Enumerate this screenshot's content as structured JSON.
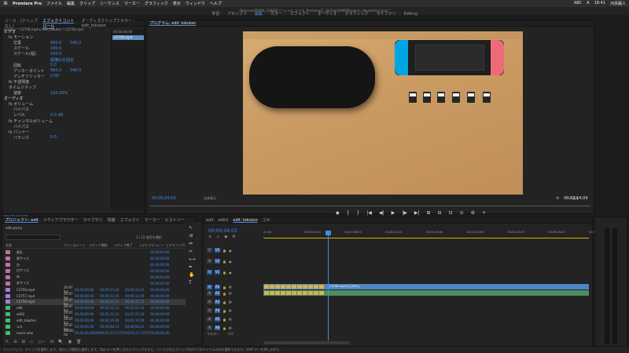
{
  "menubar": {
    "apple": "",
    "app": "Premiere Pro",
    "items": [
      "ファイル",
      "編集",
      "クリップ",
      "シーケンス",
      "マーカー",
      "グラフィック",
      "表示",
      "ウィンドウ",
      "ヘルプ"
    ],
    "right": [
      "ABC",
      "A",
      "18:41",
      "河添麗人"
    ]
  },
  "window_title": "/Volumes/WORK_128GB/ソーシャル_ビデオ_Premiere/Z_2023/edit/MM/Product_video/edit.prproj *",
  "workspaces": [
    "学習",
    "アセンブリ",
    "編集",
    "カラー",
    "エフェクト",
    "オーディオ",
    "グラフィック",
    "ライブラリ",
    "Editing"
  ],
  "effect_controls": {
    "tabs": [
      "ソース : (クリップなし)",
      "エフェクトコントロール",
      "オーディオクリップミキサー : edit_tokuten"
    ],
    "header": "マスター * C2758.mp4 ▸ edit_tokuten * C2758.mp4",
    "rows": [
      {
        "label": "ビデオ",
        "v1": "",
        "v2": "",
        "cls": "sec"
      },
      {
        "label": "fx モーション",
        "v1": "",
        "v2": "",
        "cls": "ind"
      },
      {
        "label": "位置",
        "v1": "960.0",
        "v2": "540.0",
        "cls": "ind2"
      },
      {
        "label": "スケール",
        "v1": "100.0",
        "v2": "",
        "cls": "ind2"
      },
      {
        "label": "スケール(幅)",
        "v1": "100.0",
        "v2": "",
        "cls": "ind2"
      },
      {
        "label": "",
        "v1": "縦横比を固定",
        "v2": "",
        "cls": "ind2"
      },
      {
        "label": "回転",
        "v1": "0.0",
        "v2": "",
        "cls": "ind2"
      },
      {
        "label": "アンカーポイント",
        "v1": "960.0",
        "v2": "540.0",
        "cls": "ind2"
      },
      {
        "label": "アンチフリッカー",
        "v1": "0.00",
        "v2": "",
        "cls": "ind2"
      },
      {
        "label": "fx 不透明度",
        "v1": "",
        "v2": "",
        "cls": "ind"
      },
      {
        "label": "タイムリマップ",
        "v1": "",
        "v2": "",
        "cls": "ind"
      },
      {
        "label": "速度",
        "v1": "100.00%",
        "v2": "",
        "cls": "ind2"
      },
      {
        "label": "オーディオ",
        "v1": "",
        "v2": "",
        "cls": "sec"
      },
      {
        "label": "fx ボリューム",
        "v1": "",
        "v2": "",
        "cls": "ind"
      },
      {
        "label": "バイパス",
        "v1": "",
        "v2": "",
        "cls": "ind2"
      },
      {
        "label": "レベル",
        "v1": "0.0 dB",
        "v2": "",
        "cls": "ind2"
      },
      {
        "label": "fx チャンネルボリューム",
        "v1": "",
        "v2": "",
        "cls": "ind"
      },
      {
        "label": "バイパス",
        "v1": "",
        "v2": "",
        "cls": "ind2"
      },
      {
        "label": "fx パンナー",
        "v1": "",
        "v2": "",
        "cls": "ind"
      },
      {
        "label": "バランス",
        "v1": "0.0",
        "v2": "",
        "cls": "ind2"
      }
    ],
    "mini_time": "00:00:04:00",
    "clip_name": "C2758.mp4",
    "timecode": "00:00:04:03"
  },
  "program": {
    "tab": "プログラム: edit_tokuten",
    "timecode_left": "00;00;04;03",
    "fit": "全体表示",
    "full": "フル画質",
    "timecode_right": "00;02;14;09",
    "transport": [
      "◆",
      "{",
      "}",
      "|◀",
      "◀|",
      "▶",
      "|▶",
      "▶|",
      "⊞",
      "⊟",
      "⊡",
      "⊙",
      "⚙",
      "+"
    ]
  },
  "project": {
    "tabs": [
      "プロジェクト: edit",
      "メディアブラウザー",
      "ライブラリ",
      "情報",
      "エフェクト",
      "マーカー",
      "ヒストリー"
    ],
    "name": "edit.prproj",
    "selected_count": "1 / 12 項目を選択",
    "search_placeholder": "",
    "headers": [
      "名前",
      "フレームレート",
      "メディア開始",
      "メディア終了",
      "メディアデュレー",
      "ビデオインポイント"
    ],
    "rows": [
      {
        "name": "黒丸",
        "fr": "",
        "a": "",
        "b": "",
        "c": "",
        "d": "00;00;00;00",
        "color": "#c46fa7"
      },
      {
        "name": "黒サイズ",
        "fr": "",
        "a": "",
        "b": "",
        "c": "",
        "d": "00;00;00;00",
        "color": "#c46fa7"
      },
      {
        "name": "白",
        "fr": "",
        "a": "",
        "b": "",
        "c": "",
        "d": "00;00;00;00",
        "color": "#c46fa7"
      },
      {
        "name": "白サイズ",
        "fr": "",
        "a": "",
        "b": "",
        "c": "",
        "d": "00;00;00;00",
        "color": "#c46fa7"
      },
      {
        "name": "赤",
        "fr": "",
        "a": "",
        "b": "",
        "c": "",
        "d": "00;00;00;00",
        "color": "#c46fa7"
      },
      {
        "name": "赤サイズ",
        "fr": "",
        "a": "",
        "b": "",
        "c": "",
        "d": "00;00;00;00",
        "color": "#c46fa7"
      },
      {
        "name": "C2756.mp4",
        "fr": "29.97 fps",
        "a": "00;00;00;00",
        "b": "00;00;15;00",
        "c": "00;00;15;01",
        "d": "00;00;00;00",
        "color": "#9e84d6"
      },
      {
        "name": "C2757.mp4",
        "fr": "29.97 fps",
        "a": "00;00;00;00",
        "b": "00;00;12;29",
        "c": "00;00;13;00",
        "d": "00;00;00;00",
        "color": "#9e84d6"
      },
      {
        "name": "C2758.mp4",
        "fr": "29.97 fps",
        "a": "00;00;00;00",
        "b": "00;00;21;14",
        "c": "00;00;21;15",
        "d": "00;00;00;00",
        "color": "#9e84d6",
        "sel": true
      },
      {
        "name": "edit",
        "fr": "29.97 fps",
        "a": "00;00;00;00",
        "b": "00;02;21;13",
        "c": "00;02;21;14",
        "d": "00;00;00;00",
        "color": "#3fbf6e"
      },
      {
        "name": "edit2",
        "fr": "29.97 fps",
        "a": "00;00;00;00",
        "b": "00;02;21;13",
        "c": "00;02;21;14",
        "d": "00;00;00;00",
        "color": "#3fbf6e"
      },
      {
        "name": "edit_tokuten",
        "fr": "29.97 fps",
        "a": "00;00;00;00",
        "b": "00;02;14;08",
        "c": "00;02;14;09",
        "d": "00;00;00;00",
        "color": "#3fbf6e"
      },
      {
        "name": "ユキ",
        "fr": "29.97 fps",
        "a": "00;00;00;00",
        "b": "00;00;08;13",
        "c": "00;00;08;14",
        "d": "00;00;00;00",
        "color": "#3fbf6e"
      },
      {
        "name": "music.wav",
        "fr": "48000 Hz",
        "a": "00;00;00;00000",
        "b": "00;03;17;11576",
        "c": "00;03;17;11577",
        "d": "00;00;00;00",
        "color": "#3fbf6e"
      }
    ],
    "footer": [
      "✎",
      "☰",
      "⊞",
      "▭",
      "○—",
      "⊟",
      "🔍",
      "▣",
      "🗑"
    ]
  },
  "timeline": {
    "tabs": [
      "edit",
      "edit2",
      "edit_tokuten",
      "ユキ"
    ],
    "active_tab": "edit_tokuten",
    "timecode": "00;00;04;03",
    "ticks": [
      "00;00",
      "00;00;04;00",
      "00;00;08;00",
      "00;00;12;00",
      "00;00;16;00",
      "00;00;20;00",
      "00;00;24;00",
      "00;00;28;00",
      "00;00;32;00"
    ],
    "tracks": [
      {
        "name": "V3",
        "kind": "v"
      },
      {
        "name": "V2",
        "kind": "v"
      },
      {
        "name": "V1",
        "kind": "v",
        "on": true
      },
      {
        "name": "A1",
        "kind": "a",
        "on": true
      },
      {
        "name": "A2",
        "kind": "a"
      },
      {
        "name": "A3",
        "kind": "a"
      },
      {
        "name": "A4",
        "kind": "a"
      },
      {
        "name": "A5",
        "kind": "a"
      },
      {
        "name": "A6",
        "kind": "a"
      }
    ],
    "clip_label": "C2758.mp4 [V] [50%]",
    "master": "マスター",
    "master_val": "0.0"
  },
  "status": "クリックして、クリップを選択します。他の入力範囲も選択します。Opt キーを押しながらクリックすると、リンクされたクリップ内の1つのアイテムのみを選択できます。Shift キーを押しながら..."
}
